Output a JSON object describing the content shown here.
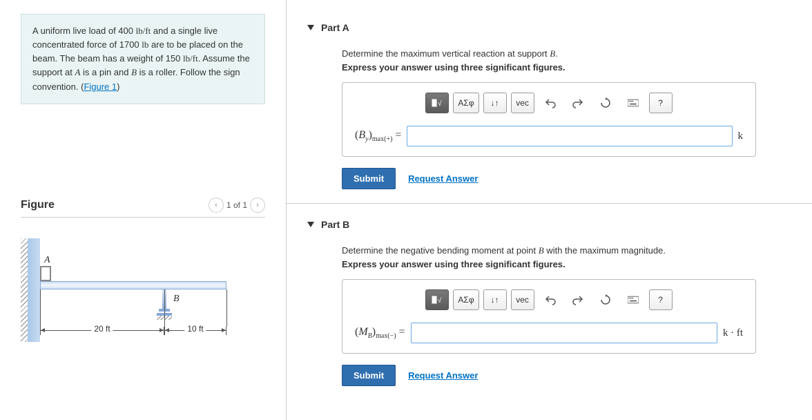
{
  "problem": {
    "text_1": "A uniform live load of 400 ",
    "unit_1": "lb/ft",
    "text_2": " and a single live concentrated force of 1700 ",
    "unit_2": "lb",
    "text_3": " are to be placed on the beam. The beam has a weight of 150 ",
    "unit_3": "lb/ft",
    "text_4": ". Assume the support at ",
    "A": "A",
    "text_5": " is a pin and ",
    "B": "B",
    "text_6": " is a roller. Follow the sign convention. (",
    "figure_link": "Figure 1",
    "text_7": ")"
  },
  "figure": {
    "title": "Figure",
    "pager_text": "1 of 1",
    "labelA": "A",
    "labelB": "B",
    "dim1": "20 ft",
    "dim2": "10 ft"
  },
  "partA": {
    "title": "Part A",
    "prompt_1": "Determine the maximum vertical reaction at support ",
    "prompt_B": "B",
    "prompt_2": ".",
    "instruction": "Express your answer using three significant figures.",
    "lhs_open": "(",
    "lhs_var": "B",
    "lhs_sub1": "y",
    "lhs_close": ")",
    "lhs_sub2": "max(+)",
    "equals": " = ",
    "unit": "k",
    "submit": "Submit",
    "request": "Request Answer"
  },
  "partB": {
    "title": "Part B",
    "prompt_1": "Determine the negative bending moment at point ",
    "prompt_B": "B",
    "prompt_2": " with the maximum magnitude.",
    "instruction": "Express your answer using three significant figures.",
    "lhs_open": "(",
    "lhs_var": "M",
    "lhs_sub1": "B",
    "lhs_close": ")",
    "lhs_sub2": "max(−)",
    "equals": " = ",
    "unit": "k · ft",
    "submit": "Submit",
    "request": "Request Answer"
  },
  "toolbar": {
    "greek": "ΑΣφ",
    "arrows": "↓↑",
    "vec": "vec",
    "help": "?"
  }
}
